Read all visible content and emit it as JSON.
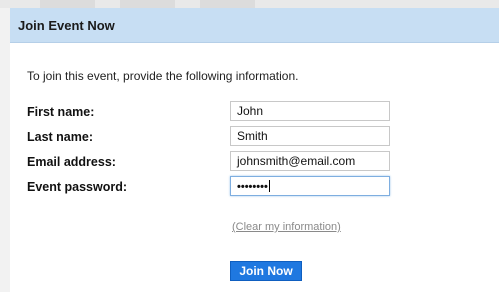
{
  "header": {
    "title": "Join Event Now"
  },
  "intro": "To join this event, provide the following information.",
  "fields": [
    {
      "label": "First name:",
      "value": "John"
    },
    {
      "label": "Last name:",
      "value": "Smith"
    },
    {
      "label": "Email address:",
      "value": "johnsmith@email.com"
    },
    {
      "label": "Event password:",
      "value": "••••••••"
    }
  ],
  "clear_link": "(Clear my information)",
  "join_button": "Join Now"
}
